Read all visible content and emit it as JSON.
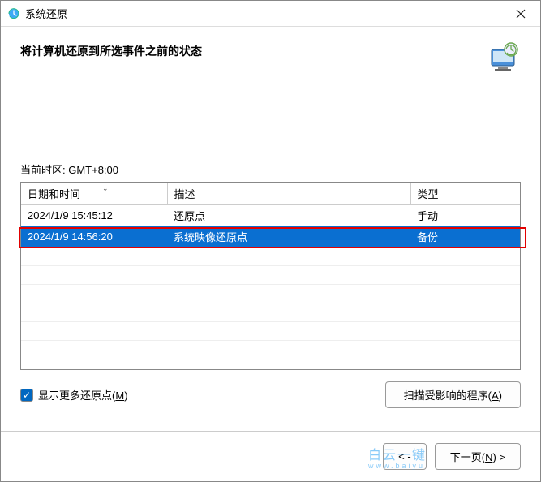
{
  "titlebar": {
    "title": "系统还原"
  },
  "header": {
    "heading": "将计算机还原到所选事件之前的状态"
  },
  "timezone_label": "当前时区: GMT+8:00",
  "table": {
    "columns": {
      "datetime": "日期和时间",
      "description": "描述",
      "type": "类型"
    },
    "rows": [
      {
        "datetime": "2024/1/9 15:45:12",
        "description": "还原点",
        "type": "手动",
        "selected": false
      },
      {
        "datetime": "2024/1/9 14:56:20",
        "description": "系统映像还原点",
        "type": "备份",
        "selected": true
      }
    ]
  },
  "checkbox": {
    "label_pre": "显示更多还原点(",
    "label_key": "M",
    "label_post": ")",
    "checked": true
  },
  "buttons": {
    "scan_pre": "扫描受影响的程序(",
    "scan_key": "A",
    "scan_post": ")",
    "back_pre": "< ",
    "back_mid": "-",
    "back_key": "",
    "next_pre": "下一页(",
    "next_key": "N",
    "next_post": ") >"
  },
  "watermark": {
    "main": "白云一键",
    "sub": "www.baiyu"
  }
}
